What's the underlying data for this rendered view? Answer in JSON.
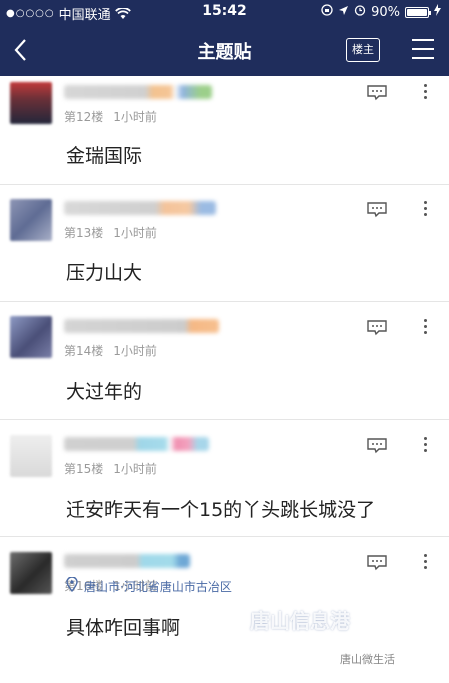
{
  "status_bar": {
    "signal": "●○○○○",
    "carrier": "中国联通",
    "time": "15:42",
    "battery": "90%",
    "battery_level": 0.9
  },
  "nav": {
    "title": "主题贴",
    "owner_label": "楼主"
  },
  "posts": [
    {
      "floor": "第12楼",
      "time": "1小时前",
      "content": "金瑞国际"
    },
    {
      "floor": "第13楼",
      "time": "1小时前",
      "content": "压力山大"
    },
    {
      "floor": "第14楼",
      "time": "1小时前",
      "content": "大过年的"
    },
    {
      "floor": "第15楼",
      "time": "1小时前",
      "content": "迁安昨天有一个15的丫头跳长城没了"
    },
    {
      "floor": "第16楼",
      "time": "1小时前",
      "content": "具体咋回事啊"
    }
  ],
  "location": "唐山市·河北省唐山市古冶区",
  "watermark": "唐山信息港",
  "watermark2": "唐山微生活",
  "colors": {
    "nav_bg": "#1f2d5c",
    "meta": "#9a9a9a",
    "location": "#4a6aa5"
  }
}
